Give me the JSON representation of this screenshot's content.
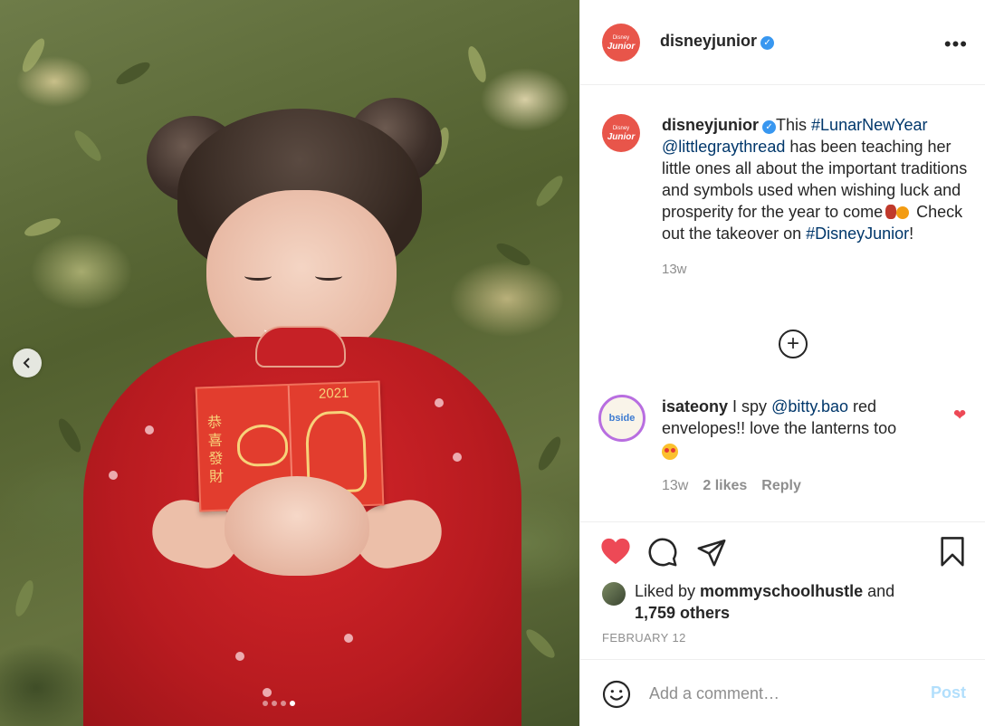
{
  "post": {
    "username": "disneyjunior",
    "verified": true,
    "avatar_text": "Junior",
    "avatar_subtext": "Disney",
    "more_label": "•••"
  },
  "photo": {
    "envelope_year": "2021",
    "envelope_chars": "恭喜發財",
    "carousel_dots": 4,
    "carousel_active": 4
  },
  "caption": {
    "username": "disneyjunior",
    "text_1": "This ",
    "hashtag_1": "#LunarNewYear",
    "mention_1": "@littlegraythread",
    "text_2": " has been teaching her little ones all about the important traditions and symbols used when wishing luck and prosperity for the year to come",
    "text_3": " Check out the takeover on ",
    "hashtag_2": "#DisneyJunior",
    "text_4": "!",
    "time": "13w"
  },
  "comments": [
    {
      "username": "isateony",
      "text_1": "I spy ",
      "mention": "@bitty.bao",
      "text_2": " red envelopes!! love the lanterns too",
      "time": "13w",
      "likes": "2 likes",
      "reply_label": "Reply",
      "avatar_text": "bside"
    }
  ],
  "actions": {
    "liked_by_prefix": "Liked by ",
    "liked_by_user": "mommyschoolhustle",
    "liked_by_suffix": " and",
    "others": "1,759 others",
    "date": "FEBRUARY 12"
  },
  "comment_box": {
    "placeholder": "Add a comment…",
    "post_label": "Post"
  },
  "colors": {
    "accent_blue": "#3897f0",
    "heart_red": "#ed4956",
    "link_blue": "#00376b",
    "post_disabled": "#b2dffc",
    "avatar_brand": "#e8554a"
  }
}
